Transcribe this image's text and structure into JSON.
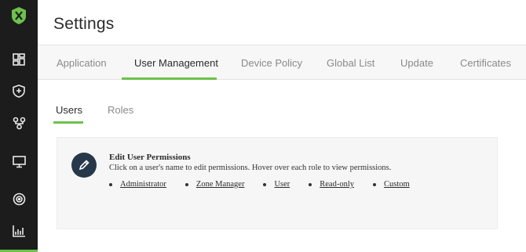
{
  "app": {
    "brand_color": "#6cc24a",
    "sidebar_bg": "#1c1c1c"
  },
  "sidebar": {
    "items": [
      {
        "icon": "logo-icon"
      },
      {
        "icon": "dashboard-icon"
      },
      {
        "icon": "shield-icon"
      },
      {
        "icon": "network-icon"
      },
      {
        "icon": "monitor-icon"
      },
      {
        "icon": "target-icon"
      },
      {
        "icon": "reports-icon"
      }
    ]
  },
  "header": {
    "title": "Settings"
  },
  "tabs": [
    {
      "label": "Application"
    },
    {
      "label": "User Management",
      "active": true
    },
    {
      "label": "Device Policy"
    },
    {
      "label": "Global List"
    },
    {
      "label": "Update"
    },
    {
      "label": "Certificates"
    }
  ],
  "subtabs": [
    {
      "label": "Users",
      "active": true
    },
    {
      "label": "Roles"
    }
  ],
  "panel": {
    "icon": "pencil-icon",
    "title": "Edit User Permissions",
    "description": "Click on a user's name to edit permissions. Hover over each role to view permissions.",
    "roles": [
      "Administrator",
      "Zone Manager",
      "User",
      "Read-only",
      "Custom"
    ]
  }
}
